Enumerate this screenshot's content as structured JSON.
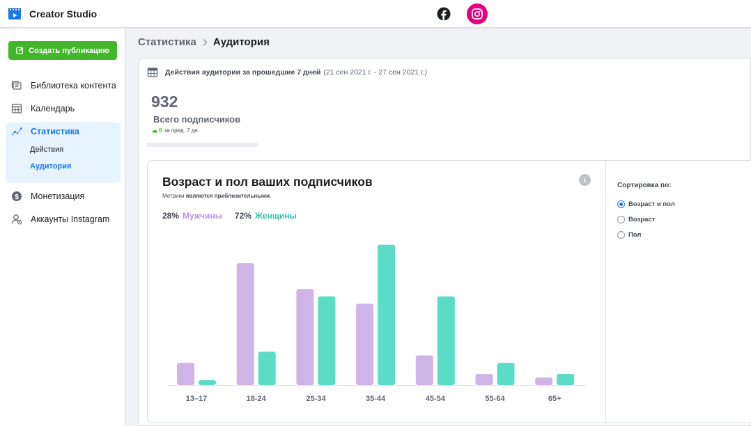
{
  "app": {
    "title": "Creator Studio"
  },
  "colors": {
    "accent": "#1877f2",
    "create": "#42b72a",
    "instagram": "#e4007c",
    "men": "#cfb4e8",
    "women": "#5bdcc6"
  },
  "sidebar": {
    "create_label": "Создать публикацию",
    "items": [
      {
        "label": "Библиотека контента",
        "icon": "content-library-icon"
      },
      {
        "label": "Календарь",
        "icon": "calendar-icon"
      },
      {
        "label": "Статистика",
        "icon": "insights-icon"
      },
      {
        "label": "Монетизация",
        "icon": "dollar-icon"
      },
      {
        "label": "Аккаунты Instagram",
        "icon": "account-settings-icon"
      }
    ],
    "subitems": [
      {
        "label": "Действия"
      },
      {
        "label": "Аудитория"
      }
    ]
  },
  "breadcrumb": {
    "root": "Статистика",
    "current": "Аудитория"
  },
  "period": {
    "label": "Действия аудитории за прошедшие 7 дней",
    "range": "(21 сен 2021 г. - 27 сен 2021 г.)"
  },
  "followers": {
    "total": "932",
    "label": "Всего подписчиков",
    "delta": "0",
    "delta_note": "за пред. 7 дн."
  },
  "chart": {
    "title": "Возраст и пол ваших подписчиков",
    "note_prefix": "Метрики ",
    "note_strong": "являются приблизительными.",
    "men_pct": "28%",
    "men_label": "Мужчины",
    "women_pct": "72%",
    "women_label": "Женщины"
  },
  "chart_data": {
    "type": "bar",
    "categories": [
      "13–17",
      "18-24",
      "25-34",
      "35-44",
      "45-54",
      "55-64",
      "65+"
    ],
    "series": [
      {
        "name": "Мужчины",
        "values": [
          6,
          33,
          26,
          22,
          8,
          3,
          2
        ]
      },
      {
        "name": "Женщины",
        "values": [
          1.3,
          9,
          24,
          38,
          24,
          6,
          3
        ]
      }
    ],
    "ylim": [
      0,
      40
    ],
    "grid": false
  },
  "sort": {
    "title": "Сортировка по:",
    "options": [
      {
        "label": "Возраст и пол",
        "selected": true
      },
      {
        "label": "Возраст",
        "selected": false
      },
      {
        "label": "Пол",
        "selected": false
      }
    ]
  }
}
